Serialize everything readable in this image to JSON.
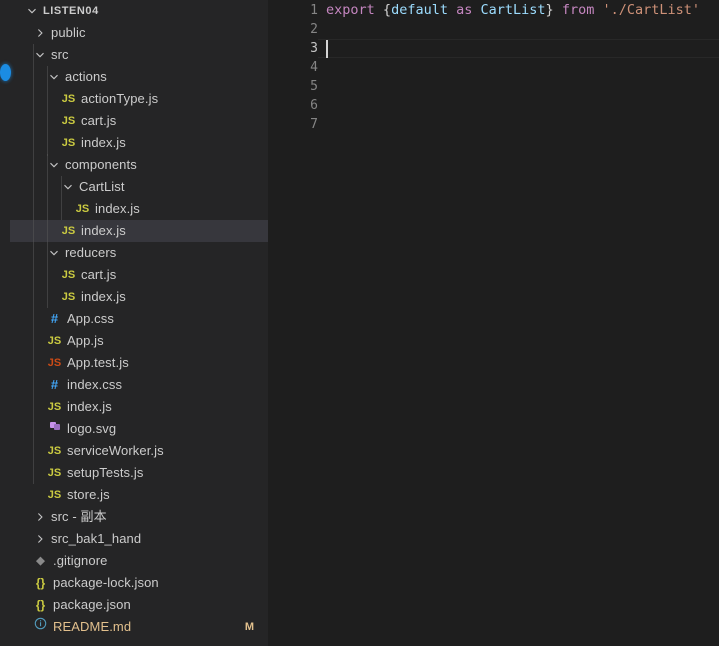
{
  "window": {
    "theme": "Dark+ (VS Code)",
    "background": "#1e1e1e",
    "sidebar_background": "#252526",
    "selection_background": "#37373d",
    "accent": "#1b8ce3"
  },
  "sidebar": {
    "root": {
      "label": "LISTEN04",
      "twisty": "chevron-down-icon"
    },
    "items": [
      {
        "label": "public",
        "depth": 1,
        "type": "folder",
        "twisty": "chevron-right-icon",
        "icon": null,
        "selected": false,
        "badge": ""
      },
      {
        "label": "src",
        "depth": 1,
        "type": "folder",
        "twisty": "chevron-down-icon",
        "icon": null,
        "selected": false,
        "badge": ""
      },
      {
        "label": "actions",
        "depth": 2,
        "type": "folder",
        "twisty": "chevron-down-icon",
        "icon": null,
        "selected": false,
        "badge": ""
      },
      {
        "label": "actionType.js",
        "depth": 3,
        "type": "file",
        "twisty": null,
        "icon": "js-icon",
        "selected": false,
        "badge": ""
      },
      {
        "label": "cart.js",
        "depth": 3,
        "type": "file",
        "twisty": null,
        "icon": "js-icon",
        "selected": false,
        "badge": ""
      },
      {
        "label": "index.js",
        "depth": 3,
        "type": "file",
        "twisty": null,
        "icon": "js-icon",
        "selected": false,
        "badge": ""
      },
      {
        "label": "components",
        "depth": 2,
        "type": "folder",
        "twisty": "chevron-down-icon",
        "icon": null,
        "selected": false,
        "badge": ""
      },
      {
        "label": "CartList",
        "depth": 3,
        "type": "folder",
        "twisty": "chevron-down-icon",
        "icon": null,
        "selected": false,
        "badge": ""
      },
      {
        "label": "index.js",
        "depth": 4,
        "type": "file",
        "twisty": null,
        "icon": "js-icon",
        "selected": false,
        "badge": ""
      },
      {
        "label": "index.js",
        "depth": 3,
        "type": "file",
        "twisty": null,
        "icon": "js-icon",
        "selected": true,
        "badge": ""
      },
      {
        "label": "reducers",
        "depth": 2,
        "type": "folder",
        "twisty": "chevron-down-icon",
        "icon": null,
        "selected": false,
        "badge": ""
      },
      {
        "label": "cart.js",
        "depth": 3,
        "type": "file",
        "twisty": null,
        "icon": "js-icon",
        "selected": false,
        "badge": ""
      },
      {
        "label": "index.js",
        "depth": 3,
        "type": "file",
        "twisty": null,
        "icon": "js-icon",
        "selected": false,
        "badge": ""
      },
      {
        "label": "App.css",
        "depth": 2,
        "type": "file",
        "twisty": null,
        "icon": "css-icon",
        "selected": false,
        "badge": ""
      },
      {
        "label": "App.js",
        "depth": 2,
        "type": "file",
        "twisty": null,
        "icon": "js-icon",
        "selected": false,
        "badge": ""
      },
      {
        "label": "App.test.js",
        "depth": 2,
        "type": "file",
        "twisty": null,
        "icon": "js-test-icon",
        "selected": false,
        "badge": ""
      },
      {
        "label": "index.css",
        "depth": 2,
        "type": "file",
        "twisty": null,
        "icon": "css-icon",
        "selected": false,
        "badge": ""
      },
      {
        "label": "index.js",
        "depth": 2,
        "type": "file",
        "twisty": null,
        "icon": "js-icon",
        "selected": false,
        "badge": ""
      },
      {
        "label": "logo.svg",
        "depth": 2,
        "type": "file",
        "twisty": null,
        "icon": "svg-icon",
        "selected": false,
        "badge": ""
      },
      {
        "label": "serviceWorker.js",
        "depth": 2,
        "type": "file",
        "twisty": null,
        "icon": "js-icon",
        "selected": false,
        "badge": ""
      },
      {
        "label": "setupTests.js",
        "depth": 2,
        "type": "file",
        "twisty": null,
        "icon": "js-icon",
        "selected": false,
        "badge": ""
      },
      {
        "label": "store.js",
        "depth": 2,
        "type": "file",
        "twisty": null,
        "icon": "js-icon",
        "selected": false,
        "badge": ""
      },
      {
        "label": "src - 副本",
        "depth": 1,
        "type": "folder",
        "twisty": "chevron-right-icon",
        "icon": null,
        "selected": false,
        "badge": ""
      },
      {
        "label": "src_bak1_hand",
        "depth": 1,
        "type": "folder",
        "twisty": "chevron-right-icon",
        "icon": null,
        "selected": false,
        "badge": ""
      },
      {
        "label": ".gitignore",
        "depth": 1,
        "type": "file",
        "twisty": null,
        "icon": "git-icon",
        "selected": false,
        "badge": ""
      },
      {
        "label": "package-lock.json",
        "depth": 1,
        "type": "file",
        "twisty": null,
        "icon": "json-icon",
        "selected": false,
        "badge": ""
      },
      {
        "label": "package.json",
        "depth": 1,
        "type": "file",
        "twisty": null,
        "icon": "json-icon",
        "selected": false,
        "badge": ""
      },
      {
        "label": "README.md",
        "depth": 1,
        "type": "file",
        "twisty": null,
        "icon": "info-icon",
        "selected": false,
        "badge": "M",
        "modified": true
      }
    ]
  },
  "editor": {
    "line_numbers": [
      "1",
      "2",
      "3",
      "4",
      "5",
      "6",
      "7"
    ],
    "active_line": 3,
    "cursor": {
      "line": 3,
      "column": 1
    },
    "lines": [
      {
        "number": 1,
        "tokens": [
          {
            "text": "export",
            "kind": "keyword"
          },
          {
            "text": " ",
            "kind": "plain"
          },
          {
            "text": "{",
            "kind": "brace"
          },
          {
            "text": "default",
            "kind": "variable"
          },
          {
            "text": " ",
            "kind": "plain"
          },
          {
            "text": "as",
            "kind": "keyword"
          },
          {
            "text": " ",
            "kind": "plain"
          },
          {
            "text": "CartList",
            "kind": "variable"
          },
          {
            "text": "}",
            "kind": "brace"
          },
          {
            "text": " ",
            "kind": "plain"
          },
          {
            "text": "from",
            "kind": "keyword"
          },
          {
            "text": " ",
            "kind": "plain"
          },
          {
            "text": "'./CartList'",
            "kind": "string"
          }
        ]
      },
      {
        "number": 2,
        "tokens": []
      },
      {
        "number": 3,
        "tokens": []
      },
      {
        "number": 4,
        "tokens": []
      },
      {
        "number": 5,
        "tokens": []
      },
      {
        "number": 6,
        "tokens": []
      },
      {
        "number": 7,
        "tokens": []
      }
    ],
    "colors": {
      "keyword": "#c586c0",
      "variable": "#9cdcfe",
      "brace": "#d4d4d4",
      "string": "#ce9178",
      "line_number": "#858585",
      "line_number_active": "#c6c6c6",
      "caret": "#d4d4d4"
    }
  }
}
